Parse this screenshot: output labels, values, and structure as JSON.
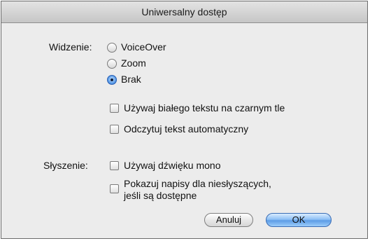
{
  "dialog": {
    "title": "Uniwersalny dostęp"
  },
  "vision": {
    "label": "Widzenie:",
    "options": [
      "VoiceOver",
      "Zoom",
      "Brak"
    ],
    "selected": "Brak",
    "checkboxes": [
      {
        "label": "Używaj białego tekstu na czarnym tle",
        "checked": false
      },
      {
        "label": "Odczytuj tekst automatyczny",
        "checked": false
      }
    ]
  },
  "hearing": {
    "label": "Słyszenie:",
    "checkboxes": [
      {
        "label": "Używaj dźwięku mono",
        "checked": false
      },
      {
        "label_line1": "Pokazuj napisy dla niesłyszących,",
        "label_line2": "jeśli są dostępne",
        "checked": false
      }
    ]
  },
  "buttons": {
    "cancel": "Anuluj",
    "ok": "OK"
  }
}
